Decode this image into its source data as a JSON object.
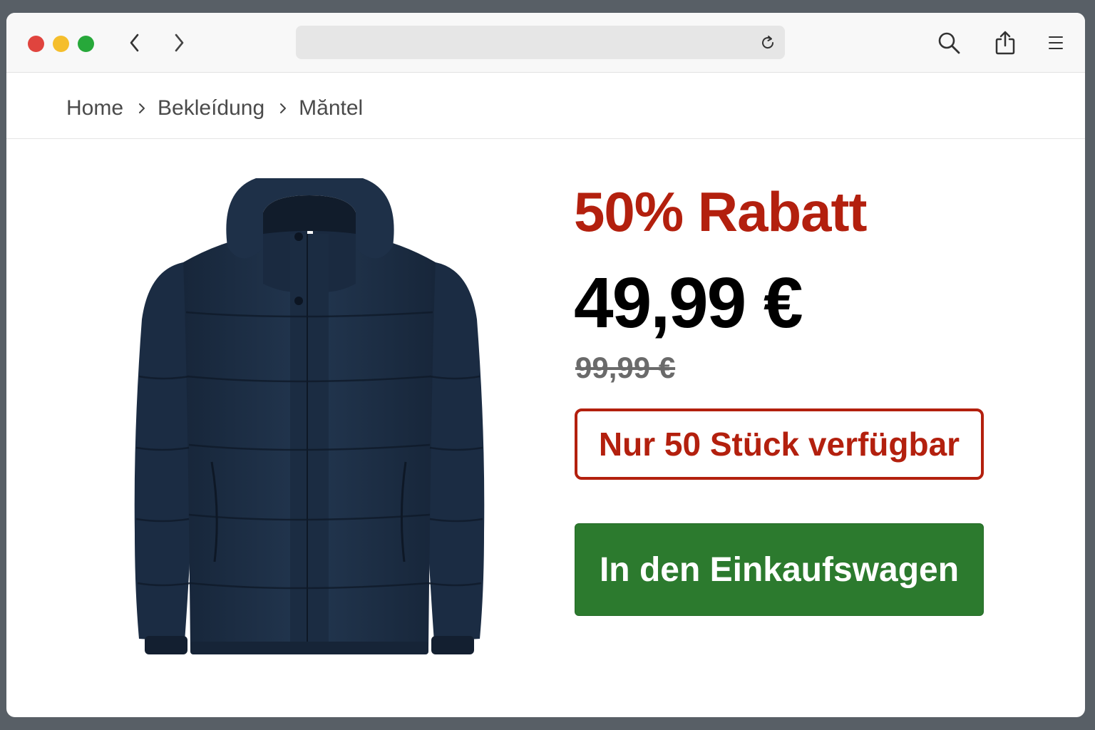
{
  "browser": {
    "url": "",
    "icons": [
      "close-dot",
      "minimize-dot",
      "zoom-dot",
      "back-arrow-icon",
      "forward-arrow-icon",
      "reload-icon",
      "search-icon",
      "share-icon",
      "menu-icon"
    ]
  },
  "breadcrumb": {
    "items": [
      "Home",
      "Bekleídung",
      "Măntel"
    ]
  },
  "product": {
    "image_icon": "puffer-jacket",
    "discount_label": "50% Rabatt",
    "price": "49,99 €",
    "old_price": "99,99 €",
    "stock_label": "Nur 50 Stück verfügbar",
    "cart_button_label": "In den Einkaufswagen"
  },
  "colors": {
    "accent_red": "#b3200e",
    "cart_green": "#2c7a2e",
    "jacket_navy": "#1f324b"
  }
}
